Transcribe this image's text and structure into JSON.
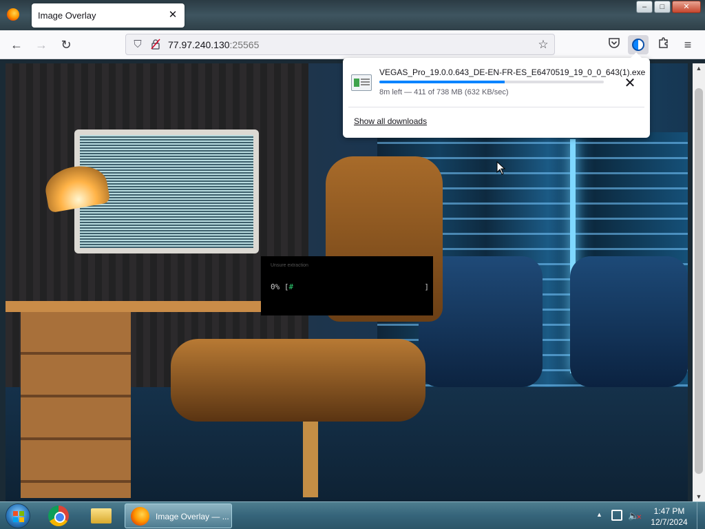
{
  "browser": {
    "tab": {
      "title": "Image Overlay",
      "close_glyph": "✕"
    },
    "window_controls": {
      "minimize": "–",
      "maximize": "□",
      "close": "✕"
    },
    "nav": {
      "back_icon": "back-arrow-icon",
      "forward_icon": "forward-arrow-icon",
      "reload_icon": "reload-icon",
      "url_host": "77.97.240.130",
      "url_port": ":25565",
      "bookmark_icon": "star-icon"
    },
    "toolbar_icons": [
      "pocket-icon",
      "downloads-icon",
      "extensions-icon",
      "menu-icon"
    ]
  },
  "downloads_panel": {
    "filename": "VEGAS_Pro_19.0.0.643_DE-EN-FR-ES_E6470519_19_0_0_643(1).exe",
    "status": "8m left — 411 of 738 MB (632 KB/sec)",
    "progress_fraction": 0.557,
    "show_all": "Show all downloads"
  },
  "loader": {
    "label": "Unsure extraction",
    "percent_text": "0% [",
    "hash": "#",
    "end": "]"
  },
  "taskbar": {
    "firefox_item": "Image Overlay — ...",
    "time": "1:47 PM",
    "date": "12/7/2024"
  },
  "colors": {
    "accent": "#0a84ff",
    "taskbar": "#35647a"
  }
}
